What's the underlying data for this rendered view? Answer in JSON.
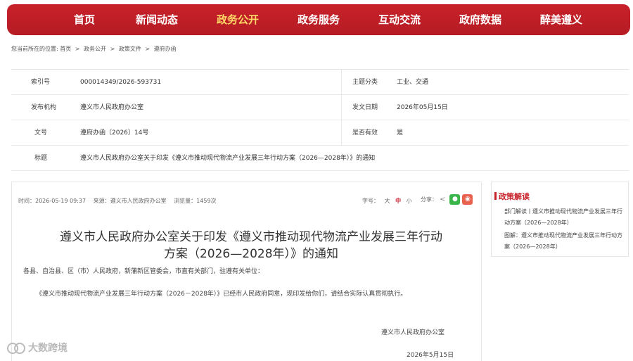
{
  "nav": {
    "items": [
      "首页",
      "新闻动态",
      "政务公开",
      "政务服务",
      "互动交流",
      "政府数据",
      "醉美遵义"
    ],
    "active_index": 2,
    "color": "#c8222b",
    "active_text_color": "#ffd966"
  },
  "breadcrumb": {
    "prefix": "您当前所在的位置:",
    "items": [
      "首页",
      "政务公开",
      "政策文件",
      "遵府办函"
    ],
    "separator": ">"
  },
  "info": {
    "rows": [
      {
        "k1": "索引号",
        "v1": "000014349/2026-593731",
        "k2": "主题分类",
        "v2": "工业、交通"
      },
      {
        "k1": "发布机构",
        "v1": "遵义市人民政府办公室",
        "k2": "发文日期",
        "v2": "2026年05月15日"
      },
      {
        "k1": "文号",
        "v1": "遵府办函〔2026〕14号",
        "k2": "是否有效",
        "v2": "是"
      },
      {
        "k1": "标题",
        "v1": "遵义市人民政府办公室关于印发《遵义市推动现代物流产业发展三年行动方案（2026—2028年）》的通知"
      }
    ]
  },
  "article": {
    "meta": {
      "time": "时间：2026-05-19 09:37",
      "source": "来源：遵义市人民政府办公室",
      "views": "浏览量：1459次"
    },
    "font_size": {
      "label": "字号：",
      "large": "大",
      "medium": "中",
      "small": "小"
    },
    "share": {
      "label": "分享："
    },
    "title": "遵义市人民政府办公室关于印发《遵义市推动现代物流产业发展三年行动方案（2026—2028年）》的通知",
    "paragraph1": "各县、自治县、区（市）人民政府，新蒲新区管委会，市直有关部门，驻遵有关单位：",
    "paragraph2": "《遵义市推动现代物流产业发展三年行动方案（2026－2028年）》已经市人民政府同意，现印发给你们，请结合实际认真贯彻执行。",
    "signature": "遵义市人民政府办公室",
    "date": "2026年5月15日"
  },
  "sidebar": {
    "title": "政策解读",
    "links": [
      "部门解读丨遵义市推动现代物流产业发展三年行动方案（2026—2028年）",
      "图解：遵义市推动现代物流产业发展三年行动方案（2026—2028年）"
    ]
  },
  "watermark": {
    "text": "大数跨境"
  }
}
